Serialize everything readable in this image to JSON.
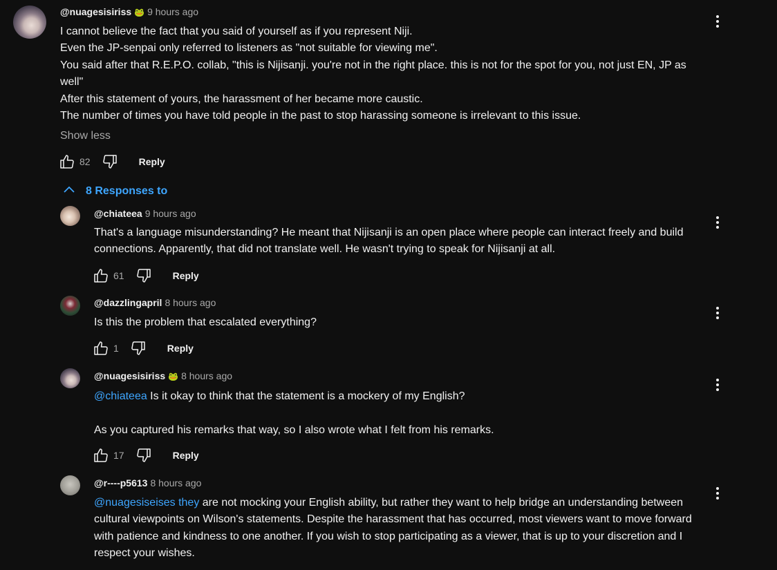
{
  "comments": [
    {
      "author": "@nuagesisiriss",
      "badge": "🐸",
      "time": "9 hours ago",
      "lines": [
        "I cannot believe the fact that you said of yourself as if you represent Niji.",
        "Even the JP-senpai only referred to listeners as \"not suitable for viewing me\".",
        "You said after that R.E.P.O. collab, \"this is Nijisanji. you're not in the right place. this is not for the spot for you, not just EN, JP as well\"",
        "After this statement of yours, the harassment of her became more caustic.",
        "The number of times you have told people in the past to stop harassing someone is irrelevant to this issue."
      ],
      "show_less": "Show less",
      "likes": "82",
      "reply_label": "Reply"
    }
  ],
  "responses_toggle": "8 Responses to",
  "replies": [
    {
      "author": "@chiateea",
      "time": "9 hours ago",
      "text": "That's a language misunderstanding? He meant that Nijisanji is an open place where people can interact freely and build connections. Apparently, that did not translate well. He wasn't trying to speak for Nijisanji at all.",
      "likes": "61",
      "reply_label": "Reply"
    },
    {
      "author": "@dazzlingapril",
      "time": "8 hours ago",
      "text": "Is this the problem that escalated everything?",
      "likes": "1",
      "reply_label": "Reply"
    },
    {
      "author": "@nuagesisiriss",
      "badge": "🐸",
      "time": "8 hours ago",
      "mention": "@chiateea",
      "text_after_mention": " Is it okay to think that the statement is a mockery of my English?",
      "text2": "As you captured his remarks that way, so I also wrote what I felt from his remarks.",
      "likes": "17",
      "reply_label": "Reply"
    },
    {
      "author": "@r----p5613",
      "time": "8 hours ago",
      "mention": "@nuagesiseises they",
      "text_after_mention": " are not mocking your English ability, but rather they want to help bridge an understanding between cultural viewpoints on Wilson's statements. Despite the harassment that has occurred, most viewers want to move forward with patience and kindness to one another. If you wish to stop participating as a viewer, that is up to your discretion and I respect your wishes."
    }
  ],
  "colors": {
    "background": "#0f0f0f",
    "text": "#f1f1f1",
    "secondary": "#aaaaaa",
    "link": "#3ea6ff"
  },
  "icons": [
    "like-icon",
    "dislike-icon",
    "more-vert-icon",
    "chevron-up-icon"
  ]
}
